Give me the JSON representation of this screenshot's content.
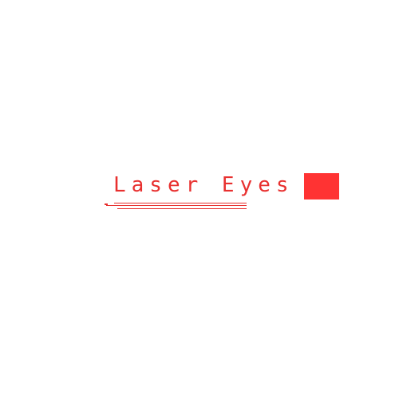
{
  "logo": {
    "title": "Laser Eyes",
    "accent_color": "#e8302f",
    "square_color": "#ff3333"
  }
}
